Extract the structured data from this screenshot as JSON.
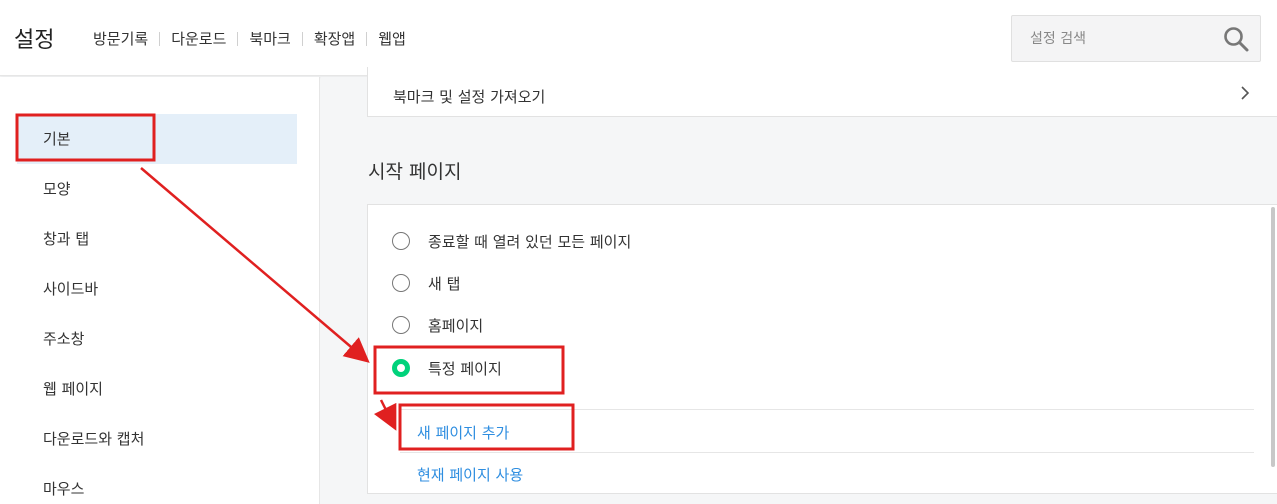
{
  "header": {
    "title": "설정",
    "tabs": [
      "방문기록",
      "다운로드",
      "북마크",
      "확장앱",
      "웹앱"
    ],
    "search": {
      "placeholder": "설정 검색",
      "icon": "search-icon"
    }
  },
  "sidebar": {
    "items": [
      {
        "label": "기본",
        "active": true
      },
      {
        "label": "모양"
      },
      {
        "label": "창과 탭"
      },
      {
        "label": "사이드바"
      },
      {
        "label": "주소창"
      },
      {
        "label": "웹 페이지"
      },
      {
        "label": "다운로드와 캡처"
      },
      {
        "label": "마우스"
      }
    ]
  },
  "main": {
    "import_row": {
      "label": "북마크 및 설정 가져오기",
      "icon": "chevron-right-icon"
    },
    "section_title": "시작 페이지",
    "radio_options": [
      {
        "label": "종료할 때 열려 있던 모든 페이지",
        "checked": false
      },
      {
        "label": "새 탭",
        "checked": false
      },
      {
        "label": "홈페이지",
        "checked": false
      },
      {
        "label": "특정 페이지",
        "checked": true
      }
    ],
    "links": {
      "add_page": "새 페이지 추가",
      "use_current": "현재 페이지 사용"
    }
  },
  "colors": {
    "accent_radio": "#00d27b",
    "link": "#2f8ee0",
    "active_bg": "#e4eff9",
    "annotation_red": "#e02020"
  }
}
